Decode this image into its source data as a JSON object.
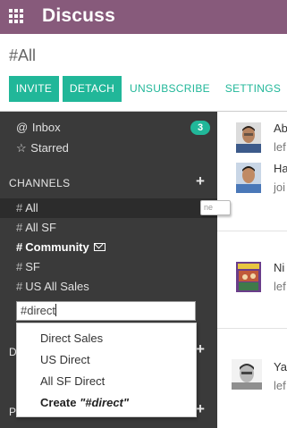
{
  "app": {
    "title": "Discuss"
  },
  "control_panel": {
    "breadcrumb": "#All",
    "buttons": {
      "invite": "INVITE",
      "detach": "DETACH",
      "unsubscribe": "UNSUBSCRIBE",
      "settings": "SETTINGS"
    }
  },
  "sidebar": {
    "inbox": {
      "label": "Inbox",
      "icon": "at-icon",
      "count": "3"
    },
    "starred": {
      "label": "Starred",
      "icon": "star-icon"
    },
    "channels_header": "CHANNELS",
    "channels": [
      {
        "label": "All"
      },
      {
        "label": "All SF"
      },
      {
        "label": "Community"
      },
      {
        "label": "SF"
      },
      {
        "label": "US All Sales"
      }
    ],
    "tooltip": "ne",
    "add_channel_input": {
      "value": "#direct"
    },
    "autocomplete": [
      {
        "label": "Direct Sales"
      },
      {
        "label": "US Direct"
      },
      {
        "label": "All SF Direct"
      },
      {
        "prefix": "Create ",
        "label": "\"#direct\""
      }
    ],
    "hidden_headers": [
      "D",
      "P"
    ]
  },
  "thread": {
    "messages": [
      {
        "author": "Ab",
        "snippet": "lef"
      },
      {
        "author": "Ha",
        "snippet": "joi"
      },
      {
        "author": "Ni",
        "snippet": "lef"
      },
      {
        "author": "Ya",
        "snippet": "lef"
      }
    ]
  },
  "colors": {
    "brand": "#875a7b",
    "accent": "#21b799",
    "sidebar_bg": "#3a3a3a"
  }
}
